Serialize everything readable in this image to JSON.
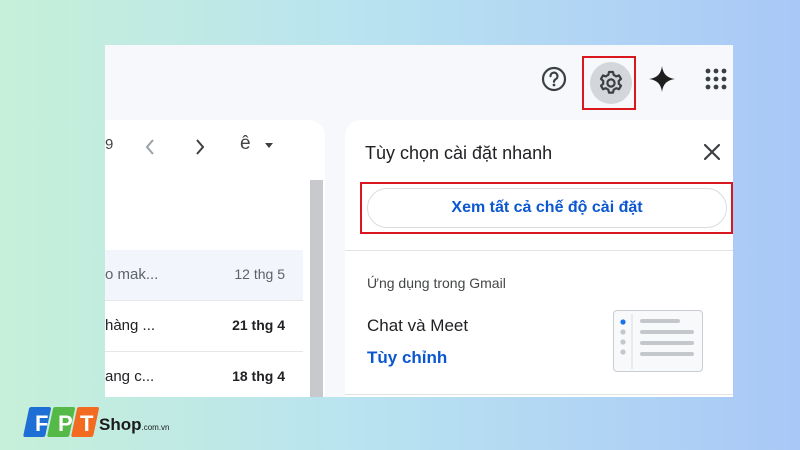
{
  "topbar": {
    "icons": [
      "help-icon",
      "settings-gear-icon",
      "gemini-spark-icon",
      "apps-grid-icon"
    ]
  },
  "mail_list": {
    "pager_partial": "9",
    "language_glyph": "ê",
    "rows": [
      {
        "subject": "o mak...",
        "date": "12 thg 5",
        "read": true
      },
      {
        "subject": " hàng ...",
        "date": "21 thg 4",
        "read": false
      },
      {
        "subject": "ang c...",
        "date": "18 thg 4",
        "read": false
      }
    ]
  },
  "quick_settings": {
    "title": "Tùy chọn cài đặt nhanh",
    "see_all_label": "Xem tất cả chế độ cài đặt",
    "section_label": "Ứng dụng trong Gmail",
    "chat_meet_label": "Chat và Meet",
    "customize_label": "Tùy chỉnh"
  },
  "logo": {
    "brand": "Shop",
    "suffix": ".com.vn"
  },
  "colors": {
    "highlight_red": "#d8171f",
    "link_blue": "#0b57d0",
    "logo_blue": "#1d6fd6",
    "logo_green": "#55b948",
    "logo_orange": "#f26b21"
  }
}
